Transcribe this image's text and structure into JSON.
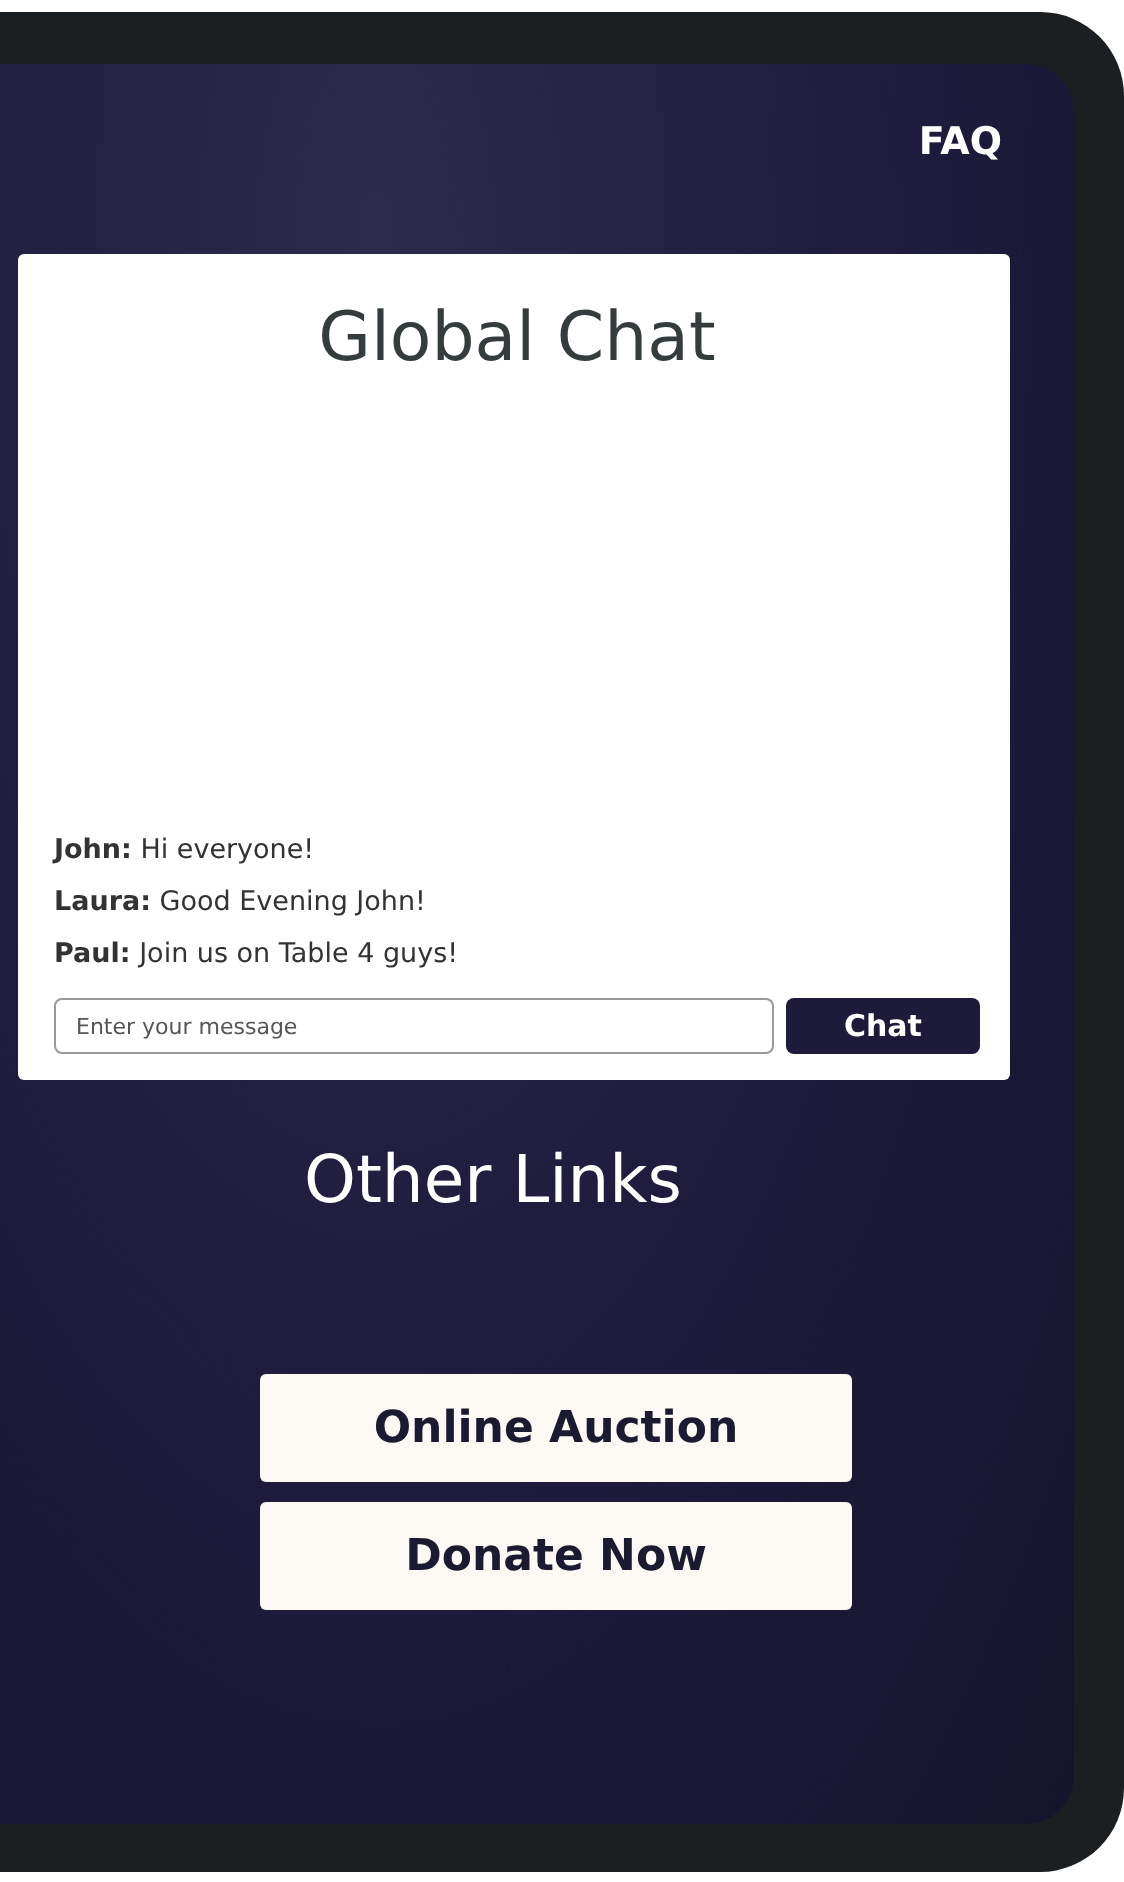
{
  "header": {
    "link": "FAQ"
  },
  "chat": {
    "title": "Global Chat",
    "messages": [
      {
        "name": "John:",
        "text": "Hi everyone!"
      },
      {
        "name": "Laura:",
        "text": "Good Evening John!"
      },
      {
        "name": "Paul:",
        "text": "Join us on Table 4 guys!"
      }
    ],
    "input": {
      "placeholder": "Enter your message"
    },
    "button": "Chat"
  },
  "links": {
    "title": "Other Links",
    "buttons": [
      "Online Auction",
      "Donate Now"
    ]
  }
}
